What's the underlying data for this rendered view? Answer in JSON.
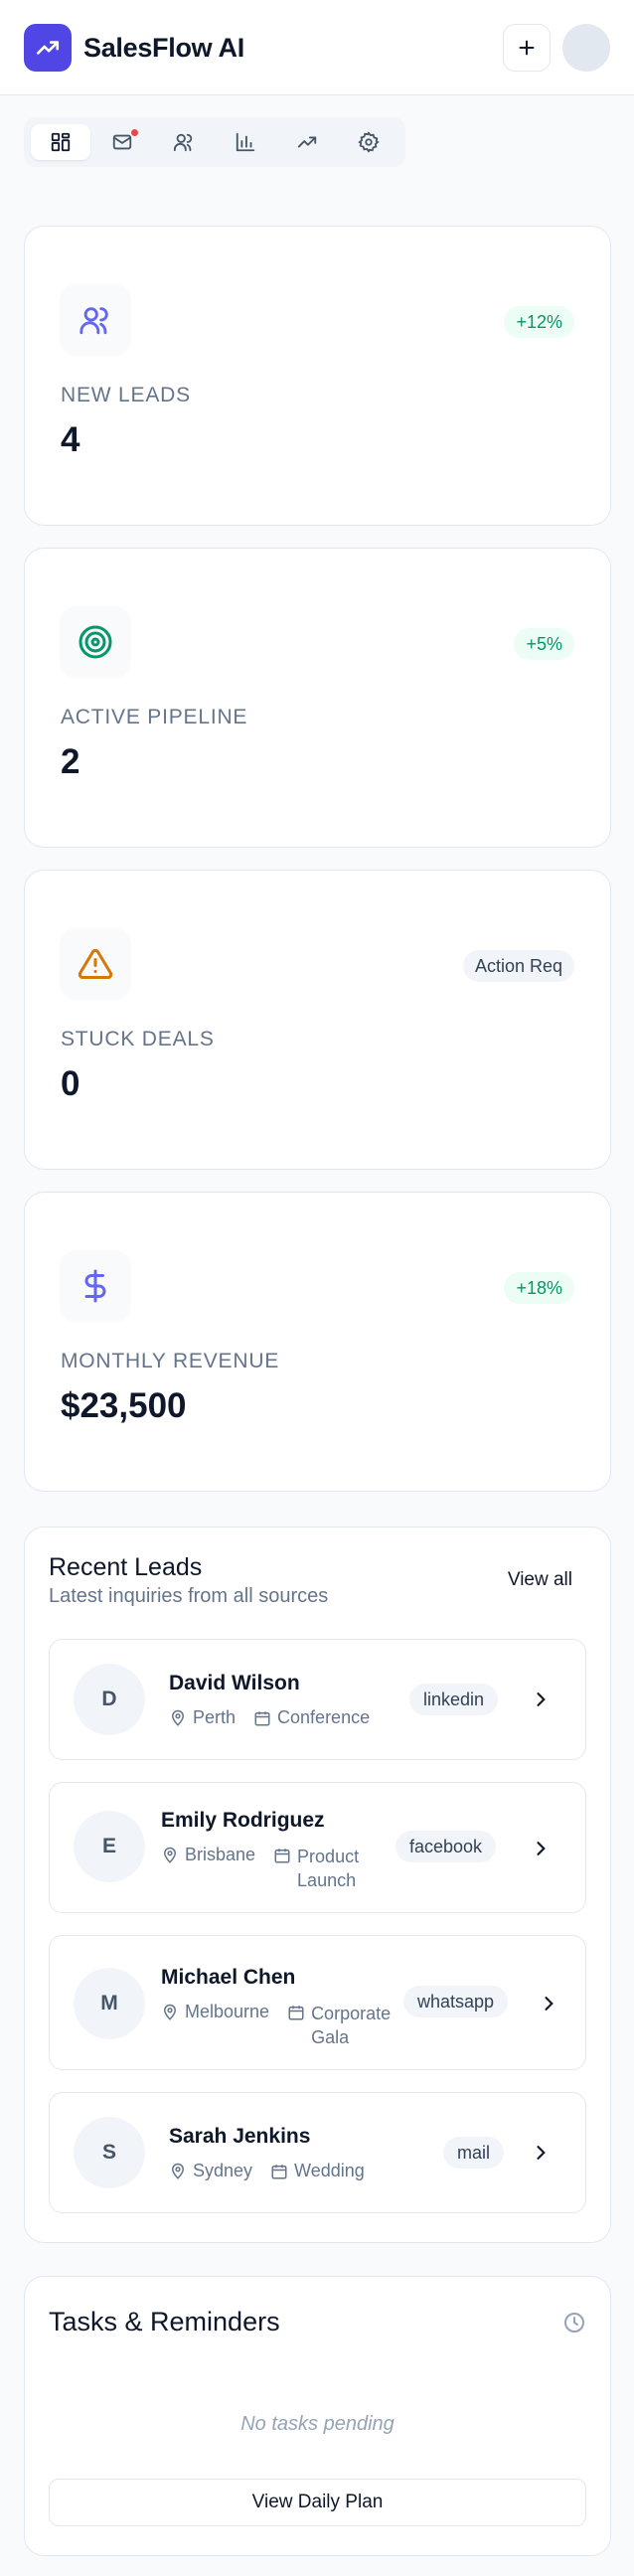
{
  "app": {
    "title": "SalesFlow AI",
    "brand_color": "#4f46e5"
  },
  "header": {
    "add_icon": "plus-icon",
    "avatar": "user-avatar"
  },
  "tabs": [
    {
      "icon": "dashboard-icon",
      "active": true
    },
    {
      "icon": "mail-icon",
      "active": false,
      "notification": true
    },
    {
      "icon": "users-icon",
      "active": false
    },
    {
      "icon": "bar-chart-icon",
      "active": false
    },
    {
      "icon": "trending-up-icon",
      "active": false
    },
    {
      "icon": "settings-icon",
      "active": false
    }
  ],
  "stats": [
    {
      "label": "New Leads",
      "value": "4",
      "badge": "+12%",
      "icon": "users-icon",
      "icon_color": "#6366f1"
    },
    {
      "label": "Active Pipeline",
      "value": "2",
      "badge": "+5%",
      "icon": "target-icon",
      "icon_color": "#059669"
    },
    {
      "label": "Stuck Deals",
      "value": "0",
      "badge": "Action Req",
      "icon": "alert-triangle-icon",
      "icon_color": "#d97706"
    },
    {
      "label": "Monthly Revenue",
      "value": "$23,500",
      "badge": "+18%",
      "icon": "dollar-icon",
      "icon_color": "#6366f1"
    }
  ],
  "recent_leads": {
    "title": "Recent Leads",
    "subtitle": "Latest inquiries from all sources",
    "view_all": "View all",
    "items": [
      {
        "initial": "D",
        "name": "David Wilson",
        "location": "Perth",
        "event": "Conference",
        "source": "linkedin"
      },
      {
        "initial": "E",
        "name": "Emily Rodriguez",
        "location": "Brisbane",
        "event": "Product Launch",
        "source": "facebook"
      },
      {
        "initial": "M",
        "name": "Michael Chen",
        "location": "Melbourne",
        "event": "Corporate Gala",
        "source": "whatsapp"
      },
      {
        "initial": "S",
        "name": "Sarah Jenkins",
        "location": "Sydney",
        "event": "Wedding",
        "source": "mail"
      }
    ]
  },
  "tasks": {
    "title": "Tasks & Reminders",
    "empty_text": "No tasks pending",
    "button_label": "View Daily Plan"
  }
}
